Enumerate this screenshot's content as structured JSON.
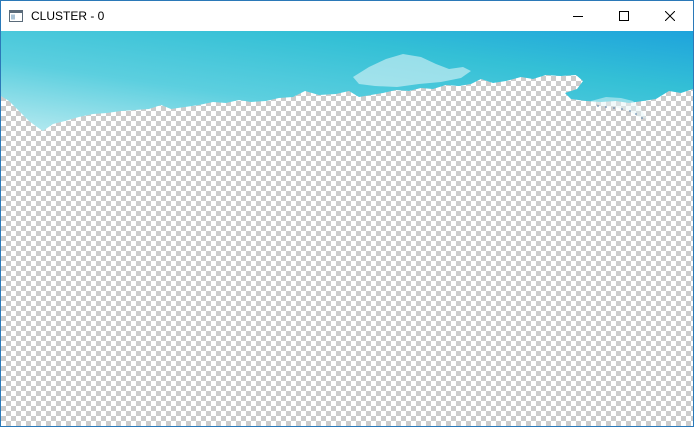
{
  "window": {
    "title": "CLUSTER - 0"
  },
  "icons": {
    "app": "app-window-icon",
    "minimize": "minimize-icon",
    "maximize": "maximize-icon",
    "close": "close-icon"
  },
  "colors": {
    "sky_light": "#7fd7e3",
    "sky_mid": "#3ec4d8",
    "sky_deep": "#1ea6db",
    "checker_dark": "#cccccc",
    "checker_light": "#ffffff",
    "window_border": "#2b79b8"
  }
}
